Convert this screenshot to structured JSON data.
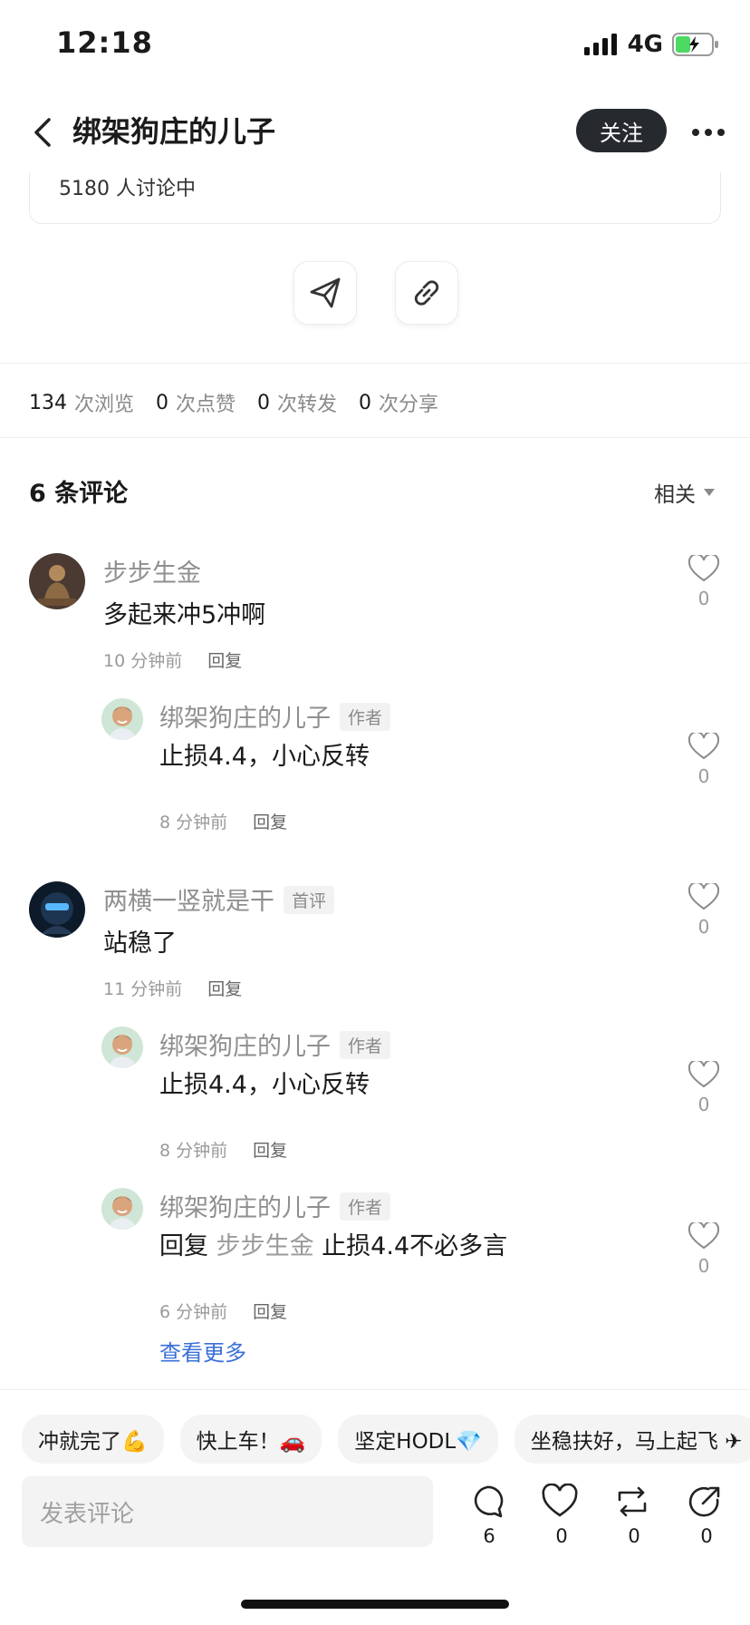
{
  "status": {
    "time": "12:18",
    "network": "4G"
  },
  "header": {
    "title": "绑架狗庄的儿子",
    "follow_label": "关注"
  },
  "card": {
    "discussion": "5180 人讨论中"
  },
  "stats": [
    {
      "num": "134",
      "label": "次浏览"
    },
    {
      "num": "0",
      "label": "次点赞"
    },
    {
      "num": "0",
      "label": "次转发"
    },
    {
      "num": "0",
      "label": "次分享"
    }
  ],
  "comments_header": {
    "title": "6 条评论",
    "sort": "相关"
  },
  "comments": [
    {
      "user": "步步生金",
      "text": "多起来冲5冲啊",
      "time": "10 分钟前",
      "reply": "回复",
      "likes": "0"
    },
    {
      "user": "绑架狗庄的儿子",
      "tag": "作者",
      "text": "止损4.4，小心反转",
      "time": "8 分钟前",
      "reply": "回复",
      "likes": "0"
    },
    {
      "user": "两横一竖就是干",
      "tag": "首评",
      "text": "站稳了",
      "time": "11 分钟前",
      "reply": "回复",
      "likes": "0"
    },
    {
      "user": "绑架狗庄的儿子",
      "tag": "作者",
      "text": "止损4.4，小心反转",
      "time": "8 分钟前",
      "reply": "回复",
      "likes": "0"
    },
    {
      "user": "绑架狗庄的儿子",
      "tag": "作者",
      "reply_prefix": "回复",
      "mention": "步步生金",
      "text": "止损4.4不必多言",
      "time": "6 分钟前",
      "reply": "回复",
      "likes": "0"
    }
  ],
  "view_more": "查看更多",
  "quick_replies": [
    "冲就完了💪",
    "快上车！🚗",
    "坚定HODL💎",
    "坐稳扶好，马上起飞 ✈"
  ],
  "composer": {
    "placeholder": "发表评论",
    "comment_count": "6",
    "like_count": "0",
    "repost_count": "0",
    "share_count": "0"
  },
  "colors": {
    "accent_link": "#3a6fd8",
    "follow_bg": "#26292e"
  }
}
